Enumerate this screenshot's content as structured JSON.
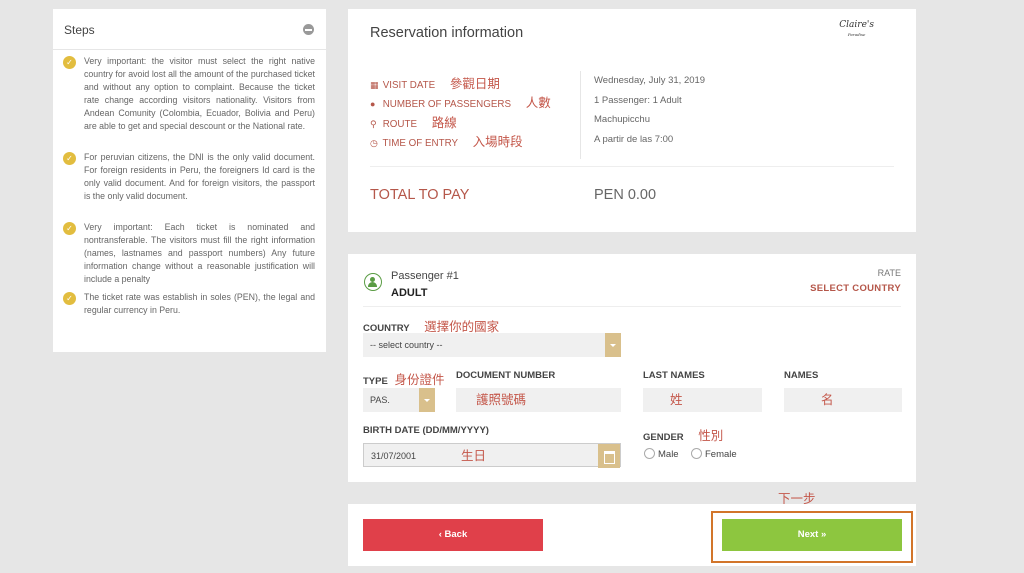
{
  "steps": {
    "title": "Steps",
    "items": [
      "Very important: the visitor must select the right native country for avoid lost all the amount of the purchased ticket and without any option to complaint. Because the ticket rate change according visitors nationality. Visitors from Andean Comunity (Colombia, Ecuador, Bolivia and Peru) are able to get and special descount or the National rate.",
      "For peruvian citizens, the DNI is the only valid document. For foreign residents in Peru, the foreigners Id card is the only valid document. And for foreign visitors, the passport is the only valid document.",
      "Very important: Each ticket is nominated and nontransferable. The visitors must fill the right information (names, lastnames and passport numbers) Any future information change without a reasonable justification will include a penalty",
      "The ticket rate was establish in soles (PEN), the legal and regular currency in Peru."
    ]
  },
  "reservation": {
    "title": "Reservation information",
    "logo": "Claire's",
    "logo_sub": "Paradise",
    "rows": [
      {
        "label": "VISIT DATE",
        "annotation": "參觀日期",
        "value": "Wednesday, July 31, 2019"
      },
      {
        "label": "NUMBER OF PASSENGERS",
        "annotation": "人數",
        "value": "1 Passenger: 1 Adult"
      },
      {
        "label": "ROUTE",
        "annotation": "路線",
        "value": "Machupicchu"
      },
      {
        "label": "TIME OF ENTRY",
        "annotation": "入場時段",
        "value": "A partir de las 7:00"
      }
    ],
    "total_label": "TOTAL TO PAY",
    "total_value": "PEN 0.00"
  },
  "passenger": {
    "number": "Passenger #1",
    "type": "ADULT",
    "rate_label": "RATE",
    "rate_value": "SELECT COUNTRY",
    "country_label": "COUNTRY",
    "country_annotation": "選擇你的國家",
    "country_value": "-- select country --",
    "type_label": "TYPE",
    "type_annotation": "身份證件",
    "type_value": "PAS.",
    "doc_label": "DOCUMENT NUMBER",
    "doc_annotation": "護照號碼",
    "lastnames_label": "LAST NAMES",
    "lastnames_annotation": "姓",
    "names_label": "NAMES",
    "names_annotation": "名",
    "birth_label": "BIRTH DATE (DD/MM/YYYY)",
    "birth_value": "31/07/2001",
    "birth_annotation": "生日",
    "gender_label": "GENDER",
    "gender_annotation": "性別",
    "male_label": "Male",
    "female_label": "Female"
  },
  "actions": {
    "back_label": "‹ Back",
    "next_label": "Next »",
    "next_annotation": "下一步"
  },
  "colors": {
    "accent_red": "#b5574a",
    "annotation": "#c4574a",
    "check_yellow": "#e2bd3f",
    "back_button": "#e0404a",
    "next_button": "#8dc63f",
    "highlight_outline": "#d2752a"
  }
}
